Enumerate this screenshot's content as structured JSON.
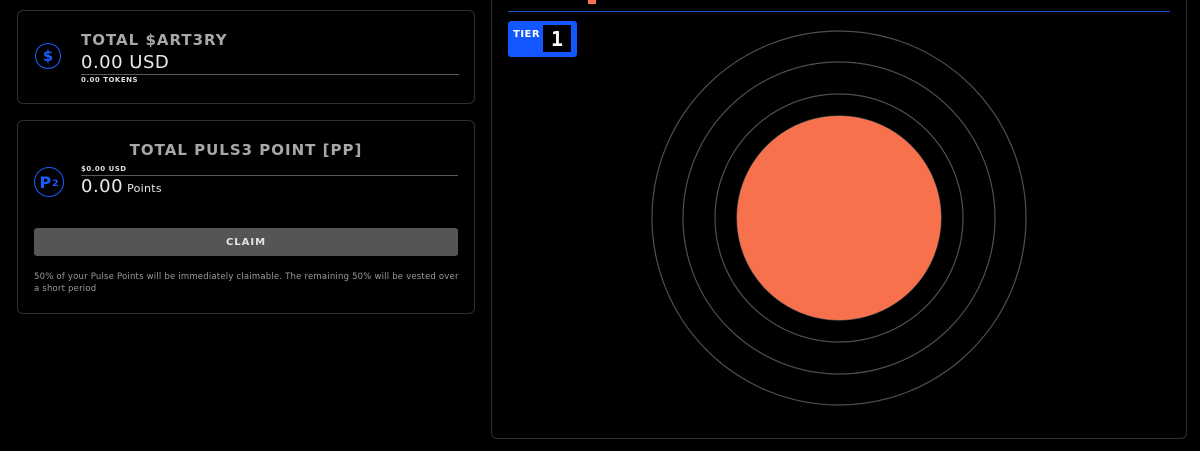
{
  "artery": {
    "icon": "dollar-coin-icon",
    "icon_glyph": "$",
    "title": "TOTAL $ART3RY",
    "value": "0.00 USD",
    "tokens": "0.00 TOKENS"
  },
  "pulse_points": {
    "icon": "pp-coin-icon",
    "icon_glyph": "P",
    "icon_sub": "2",
    "title": "TOTAL PULS3 POINT [PP]",
    "usd": "$0.00 USD",
    "value": "0.00",
    "unit": "Points",
    "claim_label": "CLAIM",
    "note": "50% of your Pulse Points will be immediately claimable. The remaining 50% will be vested over a short period"
  },
  "pulse": {
    "tier_label": "TIER",
    "tier_number": "1",
    "colors": {
      "accent": "#1456ff",
      "pulse": "#f7714d",
      "ring": "#5a5a5a"
    }
  }
}
